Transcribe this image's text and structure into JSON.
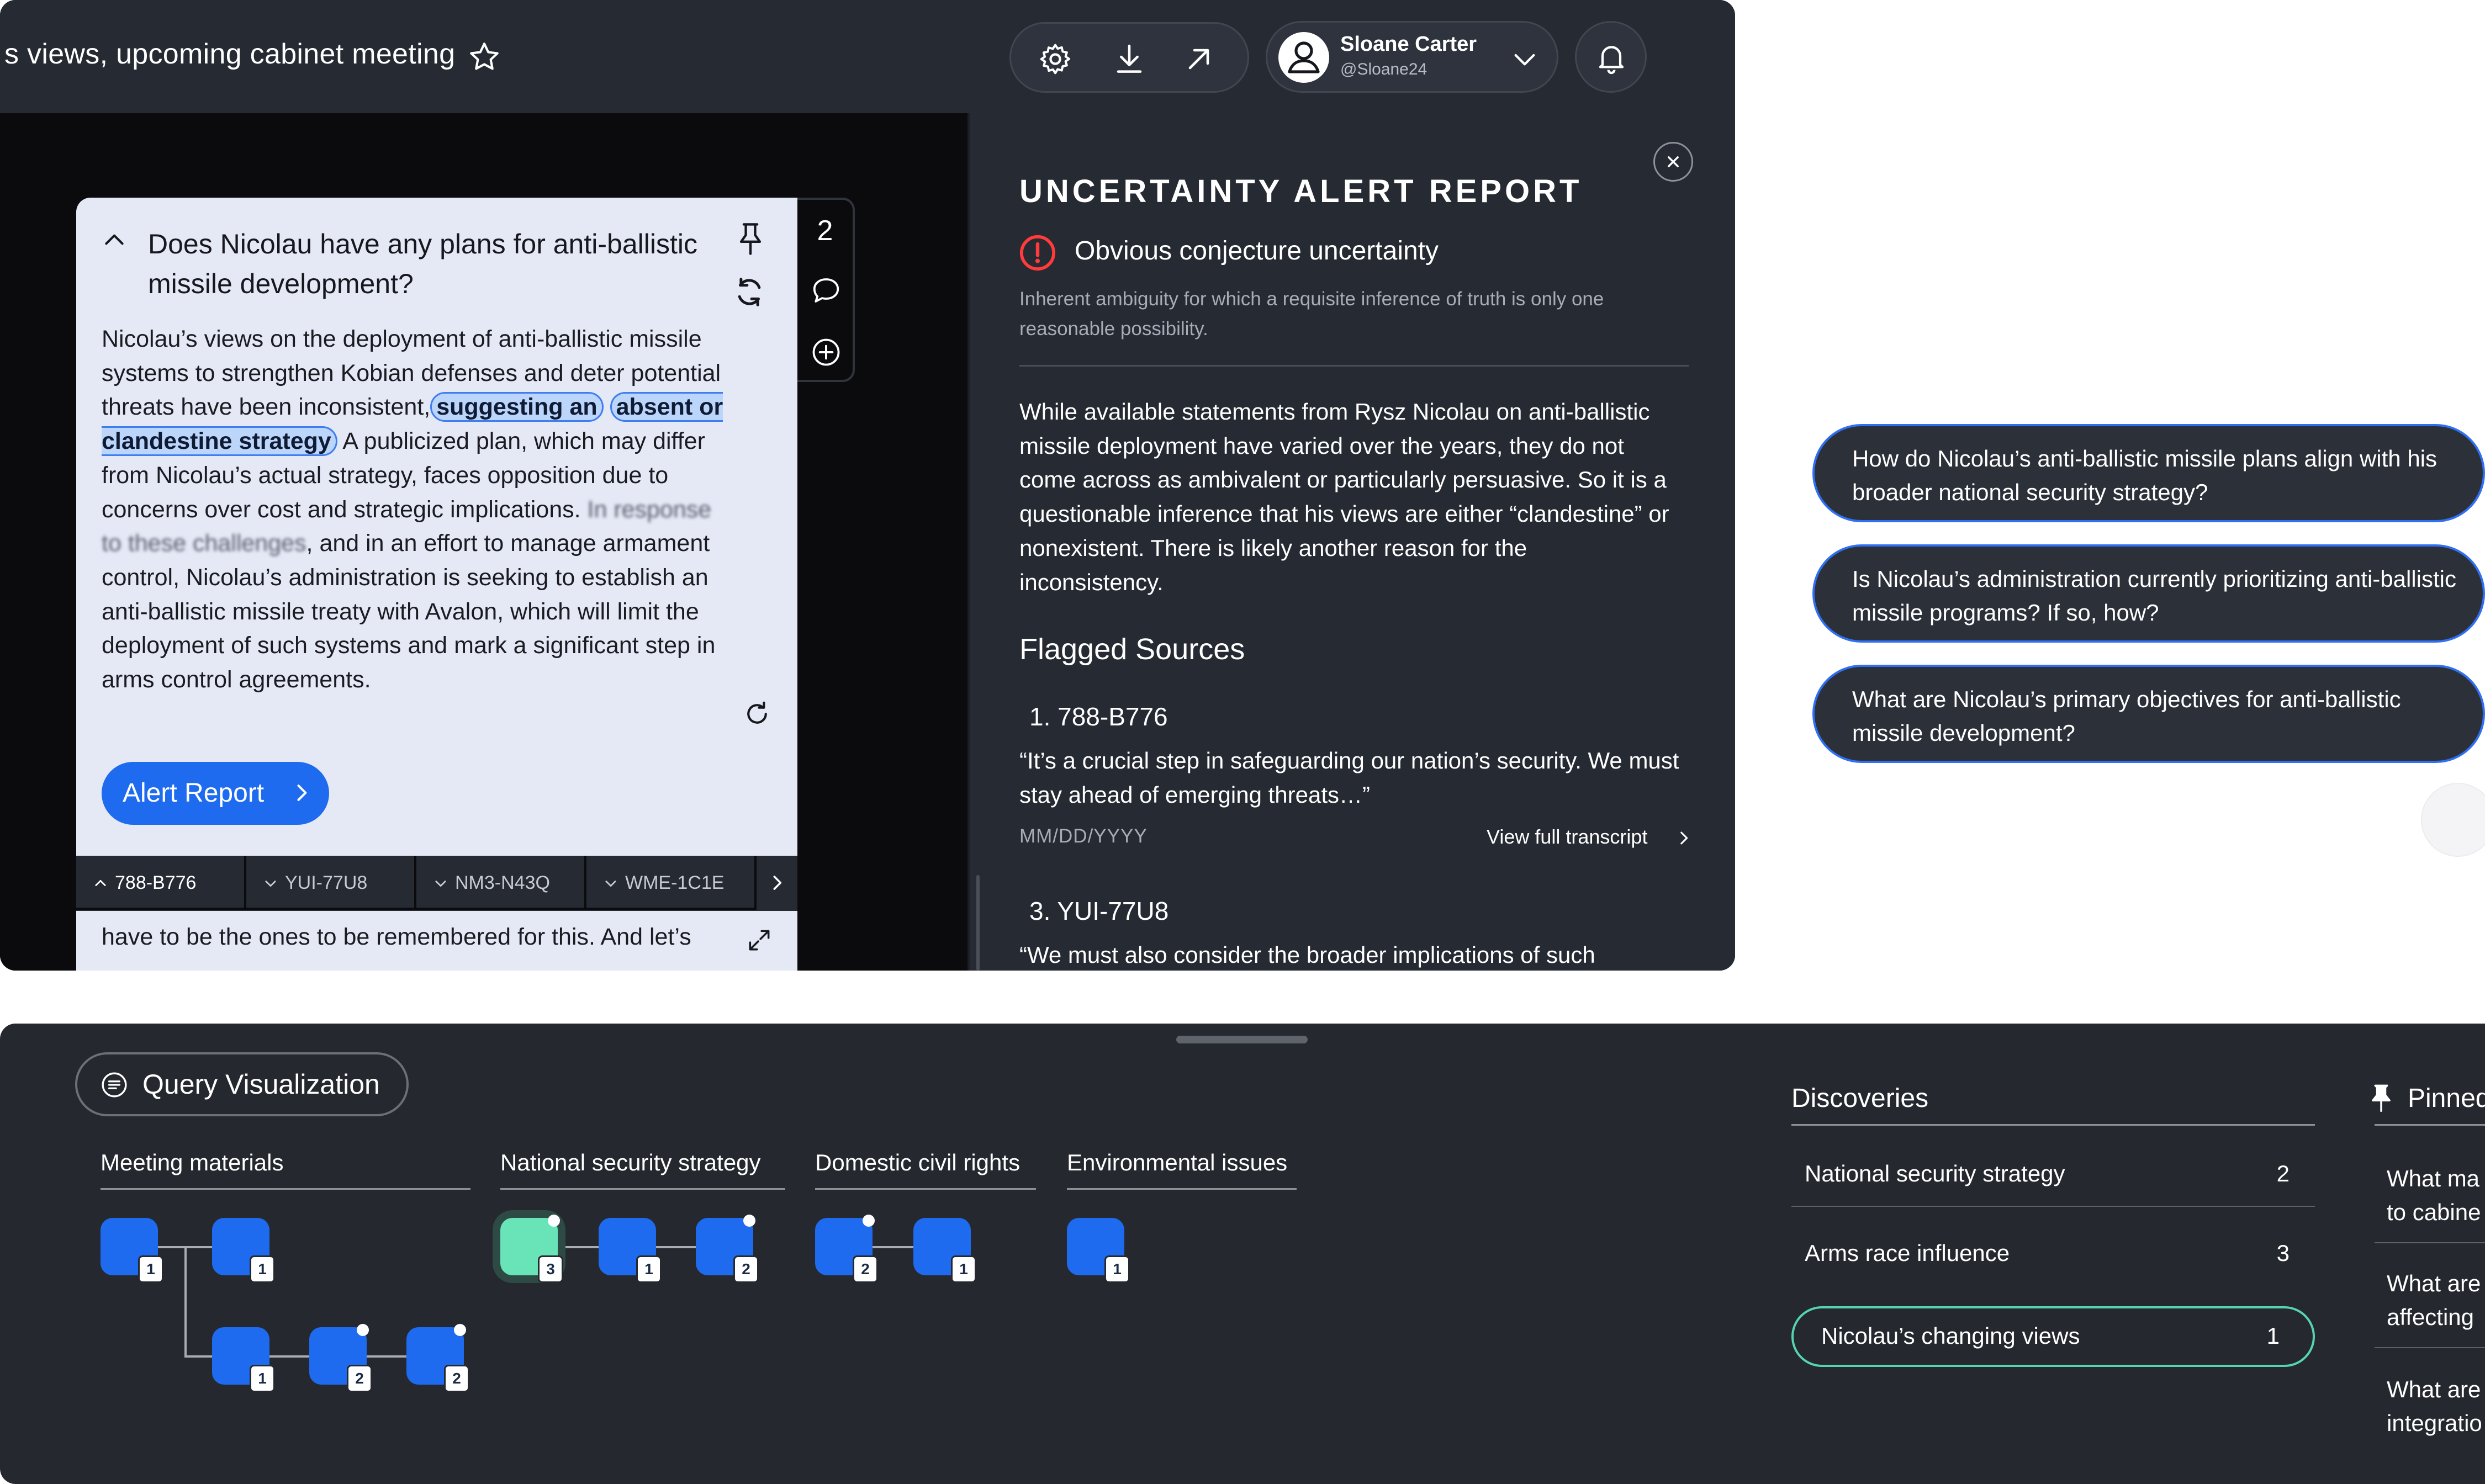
{
  "header": {
    "doc_title": "s views, upcoming cabinet meeting",
    "icons": [
      "star-icon",
      "gear-icon",
      "download-icon",
      "share-arrow-icon",
      "user-avatar-icon",
      "chevron-down-icon",
      "bell-icon"
    ],
    "user": {
      "name": "Sloane Carter",
      "handle": "@Sloane24"
    }
  },
  "qa": {
    "question": "Does Nicolau have any plans for anti-ballistic missile development?",
    "answer_parts": {
      "p1": "Nicolau’s views on the deployment of anti-ballistic missile systems to strengthen Kobian defenses and deter potential threats have been inconsistent,",
      "highlight1": "suggesting an",
      "highlight2": "absent or clandestine strategy",
      "p2": "A publicized plan, which may differ from Nicolau’s actual strategy, faces opposition due to concerns over cost and strategic implications.",
      "blurred": "In response to these challenges",
      "p3": ", and in an effort to manage armament control, Nicolau’s administration is seeking to establish an anti-ballistic missile treaty with Avalon, which will limit the deployment of such systems and mark a significant step in arms control agreements."
    },
    "alert_button": "Alert Report",
    "source_tabs": [
      "788-B776",
      "YUI-77U8",
      "NM3-N43Q",
      "WME-1C1E"
    ],
    "transcript_snippet": "have to be the ones to be remembered for this. And let’s",
    "side_count": "2"
  },
  "report": {
    "title": "UNCERTAINTY ALERT REPORT",
    "uncertainty_type": "Obvious conjecture uncertainty",
    "uncertainty_desc": "Inherent ambiguity for which a requisite inference of truth is only one reasonable possibility.",
    "body": "While available statements from Rysz Nicolau on anti-ballistic missile deployment have varied over the years, they do not come across as ambivalent or particularly persuasive. So it is a questionable inference that his views are either “clandestine” or nonexistent. There is likely another reason for the inconsistency.",
    "flagged_heading": "Flagged Sources",
    "sources": [
      {
        "number": "1. 788-B776",
        "quote": "“It’s a crucial step in safeguarding our nation’s security. We must stay ahead of emerging threats…”",
        "date": "MM/DD/YYYY",
        "link": "View full transcript"
      },
      {
        "number": "3. YUI-77U8",
        "quote": "“We must also consider the broader implications of such"
      }
    ]
  },
  "suggestions": [
    "How do Nicolau’s anti-ballistic missile plans align with his broader national security strategy?",
    "Is Nicolau’s administration currently prioritizing anti-ballistic missile programs? If so, how?",
    "What are Nicolau’s primary objectives for anti-ballistic missile development?"
  ],
  "visualization": {
    "button": "Query Visualization",
    "categories": [
      {
        "label": "Meeting materials",
        "nodes": [
          "1",
          "1",
          "1",
          "2",
          "2"
        ]
      },
      {
        "label": "National security strategy",
        "nodes": [
          "3",
          "1",
          "2"
        ]
      },
      {
        "label": "Domestic civil rights",
        "nodes": [
          "2",
          "1"
        ]
      },
      {
        "label": "Environmental issues",
        "nodes": [
          "1"
        ]
      }
    ]
  },
  "discoveries": {
    "heading": "Discoveries",
    "items": [
      {
        "label": "National security strategy",
        "count": "2"
      },
      {
        "label": "Arms race influence",
        "count": "3"
      },
      {
        "label": "Nicolau’s changing views",
        "count": "1"
      }
    ]
  },
  "pinned": {
    "heading": "Pinned",
    "items": [
      {
        "line1": "What ma",
        "line2": "to cabine"
      },
      {
        "line1": "What are",
        "line2": "affecting"
      },
      {
        "line1": "What are",
        "line2": "integratio"
      }
    ]
  },
  "colors": {
    "accent_blue": "#1f6bf0",
    "selected_node": "#69e3b8",
    "discovery_outline": "#56d4b0",
    "alert_red": "#ff3b3b"
  }
}
